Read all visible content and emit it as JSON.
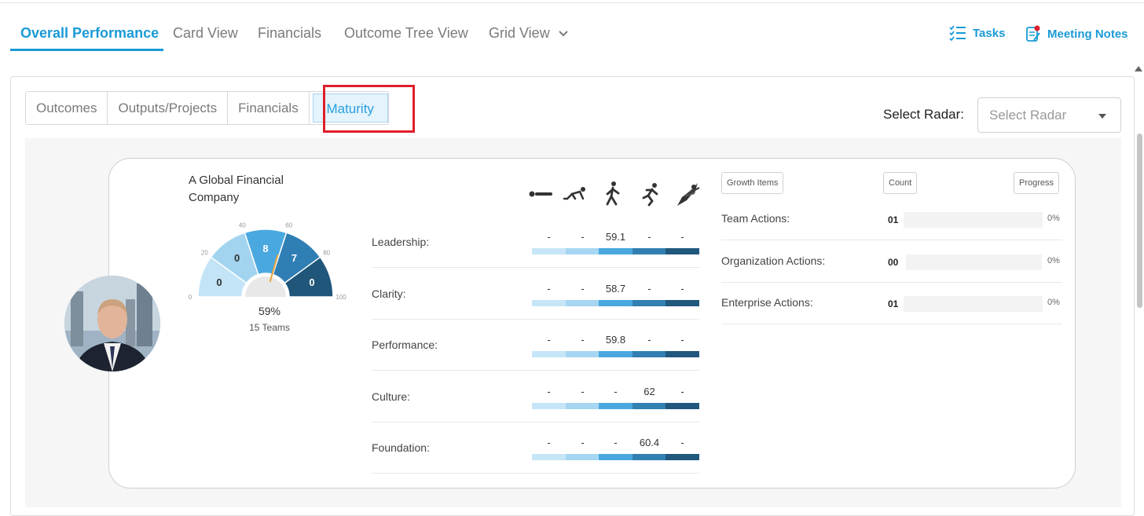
{
  "nav": {
    "tabs": [
      "Overall Performance",
      "Card View",
      "Financials",
      "Outcome Tree View",
      "Grid View"
    ],
    "tasks_label": "Tasks",
    "meeting_notes_label": "Meeting Notes"
  },
  "subtabs": [
    "Outcomes",
    "Outputs/Projects",
    "Financials",
    "Maturity"
  ],
  "radar": {
    "label": "Select Radar:",
    "placeholder": "Select Radar"
  },
  "card": {
    "company": "A Global Financial Company",
    "gauge": {
      "ticks": [
        "0",
        "20",
        "40",
        "60",
        "80",
        "100"
      ],
      "segments": [
        "0",
        "0",
        "8",
        "7",
        "0"
      ],
      "segment_colors": [
        "#c3e3f7",
        "#a2d4f0",
        "#4aa8e0",
        "#2f7fb5",
        "#1f567a"
      ],
      "percent": "59%",
      "teams": "15 Teams",
      "needle_value": 59
    },
    "stage_icons": [
      "lying-icon",
      "crawling-icon",
      "walking-icon",
      "running-icon",
      "flying-icon"
    ],
    "bar_colors": [
      "#c6e6f8",
      "#a6d6f1",
      "#4aa8e0",
      "#327fb2",
      "#21587e"
    ],
    "rows": [
      {
        "label": "Leadership:",
        "values": [
          "-",
          "-",
          "59.1",
          "-",
          "-"
        ]
      },
      {
        "label": "Clarity:",
        "values": [
          "-",
          "-",
          "58.7",
          "-",
          "-"
        ]
      },
      {
        "label": "Performance:",
        "values": [
          "-",
          "-",
          "59.8",
          "-",
          "-"
        ]
      },
      {
        "label": "Culture:",
        "values": [
          "-",
          "-",
          "-",
          "62",
          "-"
        ]
      },
      {
        "label": "Foundation:",
        "values": [
          "-",
          "-",
          "-",
          "60.4",
          "-"
        ]
      }
    ],
    "growth": {
      "headers": {
        "items": "Growth Items",
        "count": "Count",
        "progress": "Progress"
      },
      "rows": [
        {
          "label": "Team Actions:",
          "count": "01",
          "progress": "0%"
        },
        {
          "label": "Organization Actions:",
          "count": "00",
          "progress": "0%"
        },
        {
          "label": "Enterprise Actions:",
          "count": "01",
          "progress": "0%"
        }
      ]
    }
  }
}
